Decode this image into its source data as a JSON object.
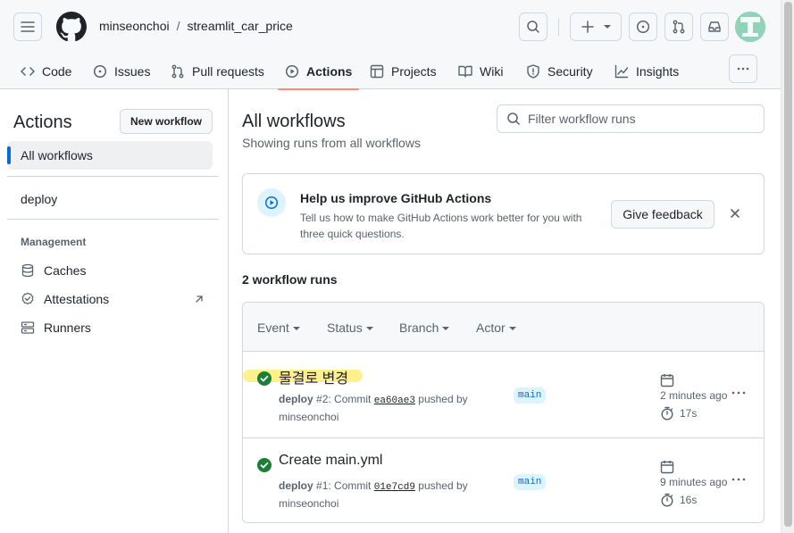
{
  "repo": {
    "owner": "minseonchoi",
    "separator": "/",
    "name": "streamlit_car_price"
  },
  "nav_tabs": [
    {
      "label": "Code",
      "icon": "code-icon"
    },
    {
      "label": "Issues",
      "icon": "issue-icon"
    },
    {
      "label": "Pull requests",
      "icon": "pull-request-icon"
    },
    {
      "label": "Actions",
      "icon": "play-icon",
      "active": true
    },
    {
      "label": "Projects",
      "icon": "table-icon"
    },
    {
      "label": "Wiki",
      "icon": "book-icon"
    },
    {
      "label": "Security",
      "icon": "shield-icon"
    },
    {
      "label": "Insights",
      "icon": "graph-icon"
    }
  ],
  "sidebar": {
    "title": "Actions",
    "new_workflow_label": "New workflow",
    "items": [
      {
        "label": "All workflows",
        "active": true
      },
      {
        "label": "deploy"
      }
    ],
    "management_heading": "Management",
    "management": [
      {
        "label": "Caches",
        "icon": "cache-icon"
      },
      {
        "label": "Attestations",
        "icon": "attestation-icon"
      },
      {
        "label": "Runners",
        "icon": "server-icon"
      }
    ]
  },
  "main": {
    "title": "All workflows",
    "subtitle": "Showing runs from all workflows",
    "filter_placeholder": "Filter workflow runs",
    "feedback": {
      "title": "Help us improve GitHub Actions",
      "description": "Tell us how to make GitHub Actions work better for you with three quick questions.",
      "button": "Give feedback"
    },
    "run_count": "2 workflow runs",
    "filters": [
      "Event",
      "Status",
      "Branch",
      "Actor"
    ],
    "runs": [
      {
        "title": "물결로 변경",
        "workflow": "deploy",
        "number": "#2",
        "commit_prefix": ": Commit ",
        "sha": "ea60ae3",
        "pushed_by": " pushed by",
        "actor": "minseonchoi",
        "branch": "main",
        "time": "2 minutes ago",
        "duration": "17s"
      },
      {
        "title": "Create main.yml",
        "workflow": "deploy",
        "number": "#1",
        "commit_prefix": ": Commit ",
        "sha": "01e7cd9",
        "pushed_by": " pushed by",
        "actor": "minseonchoi",
        "branch": "main",
        "time": "9 minutes ago",
        "duration": "16s"
      }
    ]
  },
  "colors": {
    "accent": "#0969da",
    "success": "#1a7f37",
    "tab_underline": "#fd8c73",
    "highlight": "#ffe650"
  }
}
